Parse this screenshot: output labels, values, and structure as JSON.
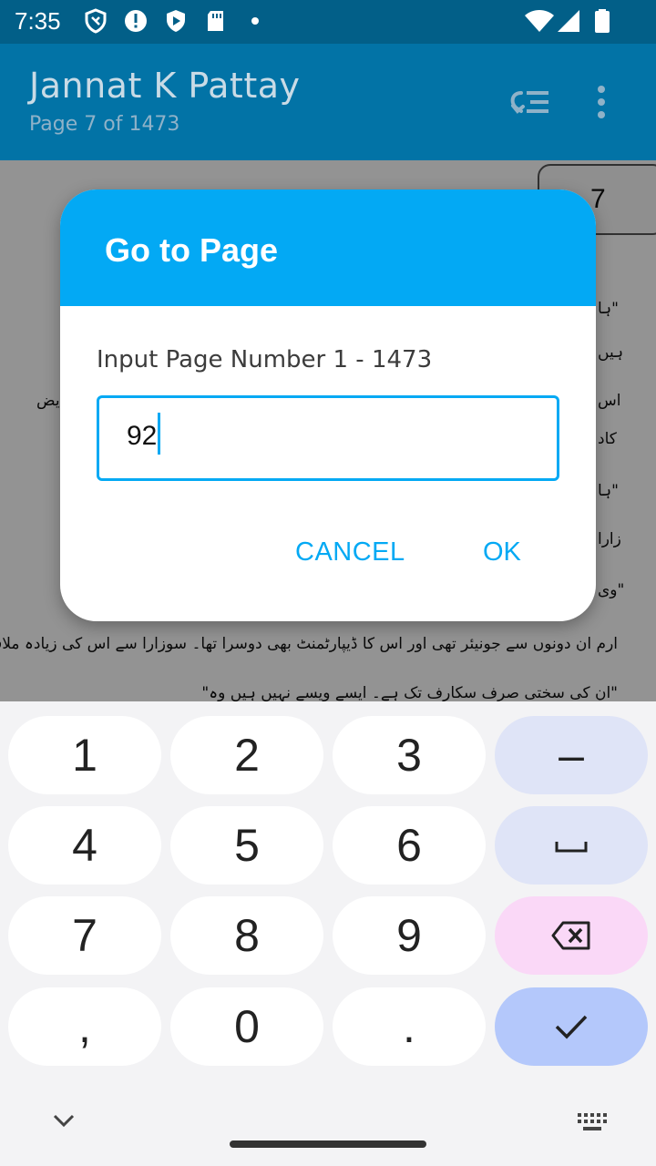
{
  "status_bar": {
    "time": "7:35",
    "icons": [
      "shield-outline-icon",
      "alert-icon",
      "play-protect-icon",
      "sd-card-icon",
      "dot-icon",
      "wifi-icon",
      "signal-icon",
      "battery-icon"
    ]
  },
  "app_bar": {
    "title": "Jannat K Pattay",
    "subtitle": "Page 7 of 1473",
    "icons": [
      "toc-icon",
      "overflow-menu-icon"
    ]
  },
  "book_page": {
    "page_badge": "7",
    "lines": [
      "ارم ان دونوں سے جونیئر تھی اور اس کا ڈیپارٹمنٹ بھی دوسرا تھا۔ سوزارا سے اس کی زیادہ ملاقات نہیں تھی۔",
      "\"ان کی سختی صرف سکارف تک ہے۔ ایسے ویسے نہیں ہیں وہ\""
    ],
    "fragments": [
      "\"ہا",
      "ہیں",
      "اس",
      "کاد",
      "\"ہا",
      "زارا",
      "\"وی",
      "یض"
    ]
  },
  "dialog": {
    "title": "Go to Page",
    "label": "Input Page Number 1 - 1473",
    "input_value": "92",
    "cancel_label": "CANCEL",
    "ok_label": "OK"
  },
  "keyboard": {
    "keys": [
      [
        "1",
        "2",
        "3",
        "–"
      ],
      [
        "4",
        "5",
        "6",
        "␣"
      ],
      [
        "7",
        "8",
        "9",
        "⌫"
      ],
      [
        ",",
        "0",
        ".",
        "✓"
      ]
    ],
    "colors": {
      "fn": "#dfe4f7",
      "delete": "#fad8f7",
      "enter": "#b4c8fb"
    }
  },
  "colors": {
    "status_bar": "#025f88",
    "app_bar": "#0273a6",
    "dialog_header": "#03a9f4",
    "accent": "#03a9f4"
  }
}
